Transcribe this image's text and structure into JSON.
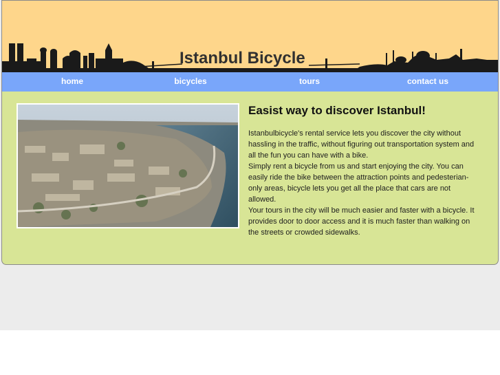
{
  "header": {
    "site_title": "Istanbul Bicycle"
  },
  "nav": {
    "items": [
      {
        "label": "home"
      },
      {
        "label": "bicycles"
      },
      {
        "label": "tours"
      },
      {
        "label": "contact us"
      }
    ]
  },
  "main": {
    "headline": "Easist way to discover Istanbul!",
    "paragraphs": [
      "Istanbulbicycle's rental service lets you discover the city without hassling in the traffic, without figuring out transportation system and all the fun you can have with a bike.",
      "Simply rent a bicycle from us and start enjoying the city. You can easily ride the bike between the attraction points and pedesterian-only areas, bicycle lets you get all the place that cars are not allowed.",
      "Your tours in the city will be much easier and faster with a bicycle. It provides door to door access and it is much faster than walking on the streets or crowded sidewalks."
    ]
  },
  "colors": {
    "header_bg": "#fed68b",
    "nav_bg": "#79a6fa",
    "content_bg": "#d8e596",
    "skyline": "#1a1a1a"
  }
}
